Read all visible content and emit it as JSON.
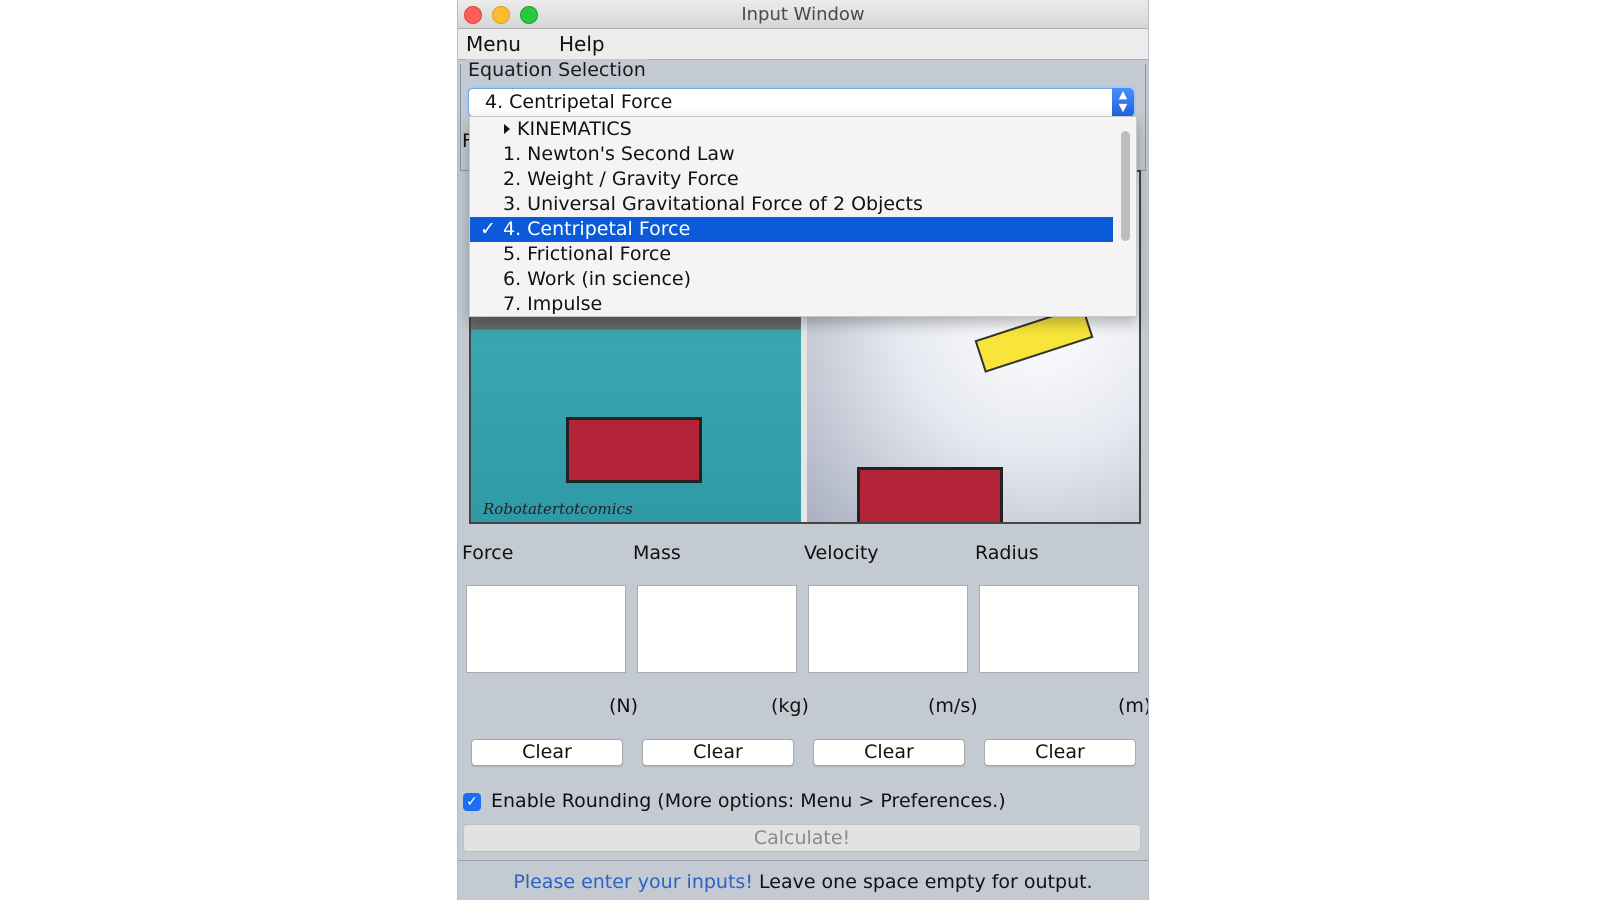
{
  "window": {
    "title": "Input Window"
  },
  "menubar": {
    "items": [
      "Menu",
      "Help"
    ]
  },
  "equation_selection": {
    "label": "Equation Selection",
    "selected": "4. Centripetal Force",
    "dropdown_items": [
      {
        "label": "KINEMATICS",
        "type": "category"
      },
      {
        "label": "1. Newton's Second Law"
      },
      {
        "label": "2. Weight / Gravity Force"
      },
      {
        "label": "3. Universal Gravitational Force of 2 Objects"
      },
      {
        "label": "4. Centripetal Force",
        "selected": true
      },
      {
        "label": "5. Frictional Force"
      },
      {
        "label": "6. Work (in science)"
      },
      {
        "label": "7. Impulse"
      }
    ],
    "check_glyph": "✓",
    "partial_label": "F"
  },
  "comic": {
    "credit": "Robotatertotcomics"
  },
  "fields": [
    {
      "label": "Force",
      "unit": "(N)",
      "value": "",
      "clear_label": "Clear"
    },
    {
      "label": "Mass",
      "unit": "(kg)",
      "value": "",
      "clear_label": "Clear"
    },
    {
      "label": "Velocity",
      "unit": "(m/s)",
      "value": "",
      "clear_label": "Clear"
    },
    {
      "label": "Radius",
      "unit": "(m)",
      "value": "",
      "clear_label": "Clear"
    }
  ],
  "rounding": {
    "label": "Enable Rounding (More options: Menu > Preferences.)",
    "checked": true,
    "check_glyph": "✓"
  },
  "calculate": {
    "label": "Calculate!"
  },
  "status": {
    "highlight": "Please enter your inputs!",
    "message": "Leave one space empty for output."
  },
  "colors": {
    "accent": "#0b5ad9",
    "status_blue": "#2a62c9",
    "window_bg": "#c3cad2"
  }
}
